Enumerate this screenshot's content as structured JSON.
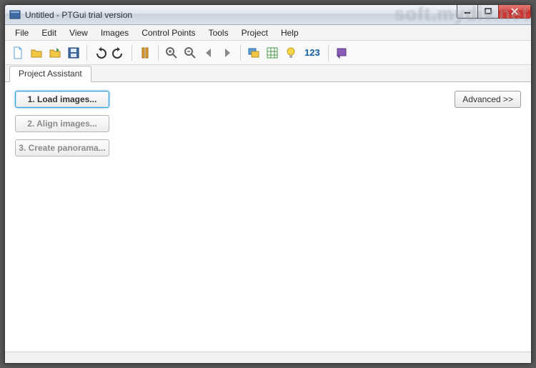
{
  "window": {
    "title": "Untitled - PTGui trial version"
  },
  "menu": {
    "file": "File",
    "edit": "Edit",
    "view": "View",
    "images": "Images",
    "control_points": "Control Points",
    "tools": "Tools",
    "project": "Project",
    "help": "Help"
  },
  "toolbar": {
    "numbers_label": "123"
  },
  "tabs": {
    "project_assistant": "Project Assistant"
  },
  "steps": {
    "load": "1. Load images...",
    "align": "2. Align images...",
    "create": "3. Create panorama..."
  },
  "buttons": {
    "advanced": "Advanced >>"
  },
  "watermark": "soft.mydiv.net"
}
